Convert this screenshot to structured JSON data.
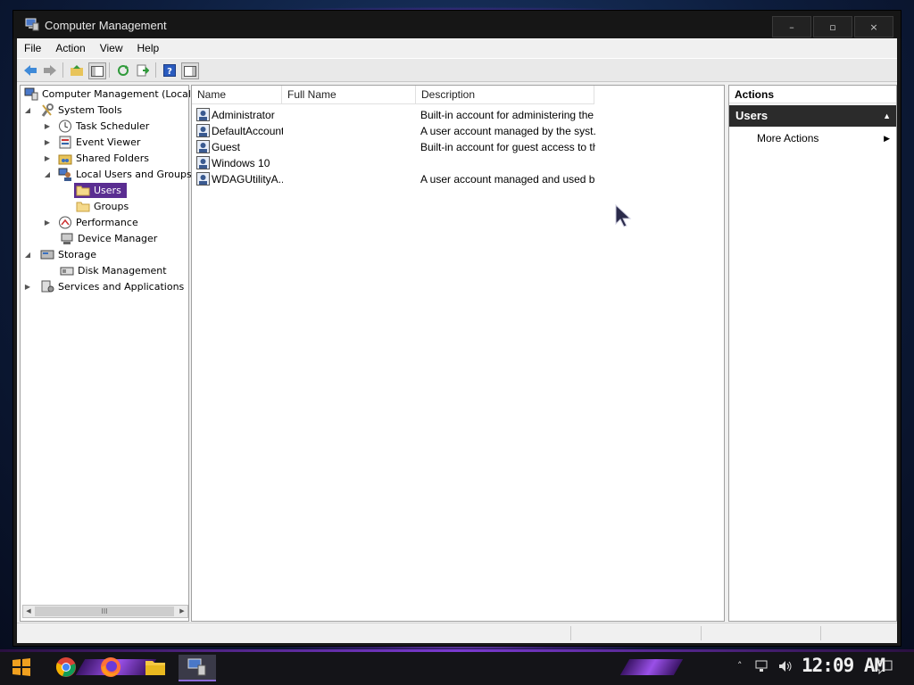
{
  "window": {
    "title": "Computer Management",
    "controls": {
      "minimize": "–",
      "maximize": "▫",
      "close": "×"
    }
  },
  "menubar": [
    "File",
    "Action",
    "View",
    "Help"
  ],
  "toolbar": {
    "icons": [
      "back-arrow-icon",
      "forward-arrow-icon",
      "up-folder-icon",
      "show-hide-console-tree-icon",
      "refresh-icon",
      "export-list-icon",
      "help-icon",
      "show-action-pane-icon"
    ]
  },
  "tree": {
    "items": [
      {
        "label": "Computer Management (Local)",
        "icon": "computer-management-icon",
        "expander": "",
        "selected": false
      },
      {
        "label": "System Tools",
        "icon": "tools-icon",
        "expander": "expanded",
        "selected": false
      },
      {
        "label": "Task Scheduler",
        "icon": "clock-icon",
        "expander": "collapsed",
        "selected": false
      },
      {
        "label": "Event Viewer",
        "icon": "event-viewer-icon",
        "expander": "collapsed",
        "selected": false
      },
      {
        "label": "Shared Folders",
        "icon": "shared-folder-icon",
        "expander": "collapsed",
        "selected": false
      },
      {
        "label": "Local Users and Groups",
        "icon": "users-groups-icon",
        "expander": "expanded",
        "selected": false
      },
      {
        "label": "Users",
        "icon": "folder-icon",
        "expander": "",
        "selected": true
      },
      {
        "label": "Groups",
        "icon": "folder-icon",
        "expander": "",
        "selected": false
      },
      {
        "label": "Performance",
        "icon": "performance-icon",
        "expander": "collapsed",
        "selected": false
      },
      {
        "label": "Device Manager",
        "icon": "device-manager-icon",
        "expander": "",
        "selected": false
      },
      {
        "label": "Storage",
        "icon": "storage-icon",
        "expander": "expanded",
        "selected": false
      },
      {
        "label": "Disk Management",
        "icon": "disk-management-icon",
        "expander": "",
        "selected": false
      },
      {
        "label": "Services and Applications",
        "icon": "services-icon",
        "expander": "collapsed",
        "selected": false
      }
    ],
    "scrollbar": {
      "thumb_grip": "III"
    }
  },
  "list": {
    "columns": [
      "Name",
      "Full Name",
      "Description"
    ],
    "rows": [
      {
        "name": "Administrator",
        "full_name": "",
        "description": "Built-in account for administering the ..."
      },
      {
        "name": "DefaultAccount",
        "full_name": "",
        "description": "A user account managed by the syst..."
      },
      {
        "name": "Guest",
        "full_name": "",
        "description": "Built-in account for guest access to th..."
      },
      {
        "name": "Windows 10",
        "full_name": "",
        "description": ""
      },
      {
        "name": "WDAGUtilityA...",
        "full_name": "",
        "description": "A user account managed and used b..."
      }
    ]
  },
  "actions": {
    "header": "Actions",
    "section": "Users",
    "items": [
      "More Actions"
    ]
  },
  "taskbar": {
    "icons": [
      "start-icon",
      "chrome-icon",
      "firefox-icon",
      "file-explorer-icon",
      "computer-management-task-icon"
    ],
    "tray_icons": [
      "tray-chevron-icon",
      "network-icon",
      "volume-icon",
      "notification-icon"
    ],
    "clock": "12:09 AM"
  },
  "colors": {
    "selection": "#5a2d91",
    "actions_section_bg": "#2b2b2b",
    "titlebar": "#161616"
  }
}
